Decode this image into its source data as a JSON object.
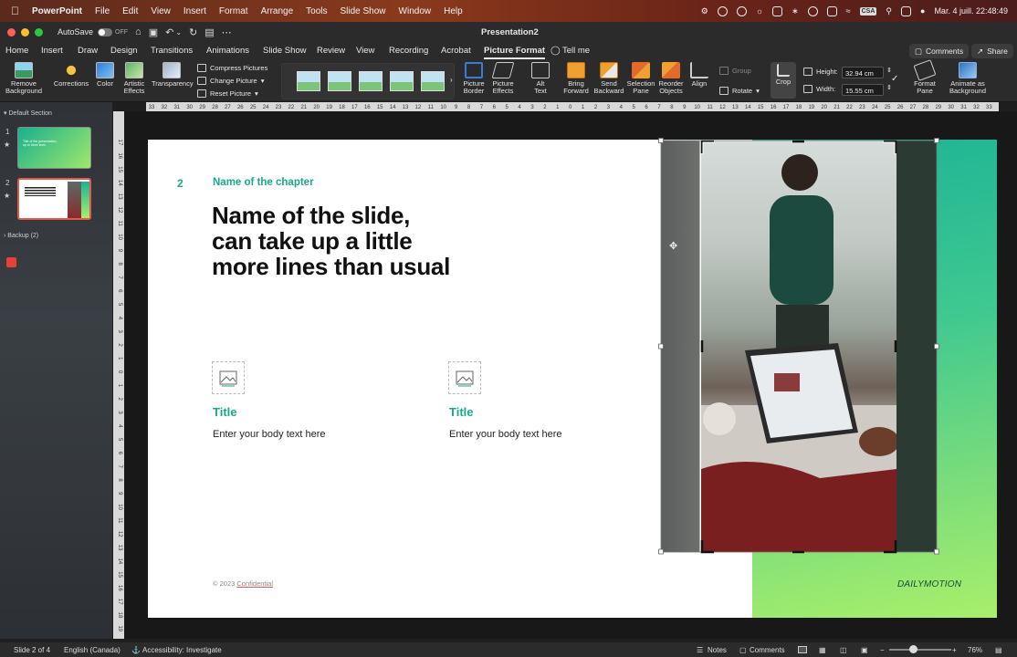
{
  "menubar": {
    "app": "PowerPoint",
    "items": [
      "File",
      "Edit",
      "View",
      "Insert",
      "Format",
      "Arrange",
      "Tools",
      "Slide Show",
      "Window",
      "Help"
    ],
    "input_source": "CSA",
    "datetime": "Mar. 4 juill. 22:48:49"
  },
  "titlebar": {
    "autosave_label": "AutoSave",
    "autosave_state": "OFF",
    "document_title": "Presentation2"
  },
  "tabs": {
    "items": [
      "Home",
      "Insert",
      "Draw",
      "Design",
      "Transitions",
      "Animations",
      "Slide Show",
      "Review",
      "View",
      "Recording",
      "Acrobat",
      "Picture Format"
    ],
    "active": "Picture Format",
    "tell_me": "Tell me",
    "comments": "Comments",
    "share": "Share"
  },
  "ribbon": {
    "remove_background": "Remove Background",
    "corrections": "Corrections",
    "color": "Color",
    "artistic_effects": "Artistic Effects",
    "transparency": "Transparency",
    "compress_pictures": "Compress Pictures",
    "change_picture": "Change Picture",
    "reset_picture": "Reset Picture",
    "picture_border": "Picture Border",
    "picture_effects": "Picture Effects",
    "alt_text": "Alt Text",
    "bring_forward": "Bring Forward",
    "send_backward": "Send Backward",
    "selection_pane": "Selection Pane",
    "reorder_objects": "Reorder Objects",
    "align": "Align",
    "group": "Group",
    "rotate": "Rotate",
    "crop": "Crop",
    "height_label": "Height:",
    "height_value": "32.94 cm",
    "width_label": "Width:",
    "width_value": "15.55 cm",
    "format_pane": "Format Pane",
    "animate_as_background": "Animate as Background"
  },
  "ruler": {
    "h_ticks": [
      "33",
      "32",
      "31",
      "30",
      "29",
      "28",
      "27",
      "26",
      "25",
      "24",
      "23",
      "22",
      "21",
      "20",
      "19",
      "18",
      "17",
      "16",
      "15",
      "14",
      "13",
      "12",
      "11",
      "10",
      "9",
      "8",
      "7",
      "6",
      "5",
      "4",
      "3",
      "2",
      "1",
      "0",
      "1",
      "2",
      "3",
      "4",
      "5",
      "6",
      "7",
      "8",
      "9",
      "10",
      "11",
      "12",
      "13",
      "14",
      "15",
      "16",
      "17",
      "18",
      "19",
      "20",
      "21",
      "22",
      "23",
      "24",
      "25",
      "26",
      "27",
      "28",
      "29",
      "30",
      "31",
      "32",
      "33"
    ],
    "v_ticks": [
      "17",
      "16",
      "15",
      "14",
      "13",
      "12",
      "11",
      "10",
      "9",
      "8",
      "7",
      "6",
      "5",
      "4",
      "3",
      "2",
      "1",
      "0",
      "1",
      "2",
      "3",
      "4",
      "5",
      "6",
      "7",
      "8",
      "9",
      "10",
      "11",
      "12",
      "13",
      "14",
      "15",
      "16",
      "17",
      "18",
      "19"
    ]
  },
  "thumbnails": {
    "section_default": "Default Section",
    "section_backup": "Backup (2)",
    "slide1_number": "1",
    "slide2_number": "2",
    "slide1_title": "Title of the presentation, up to three lines"
  },
  "slide": {
    "chapter_number": "2",
    "chapter_name": "Name of the chapter",
    "title_line1": "Name of the slide,",
    "title_line2": "can take up a little",
    "title_line3": "more lines than usual",
    "col1_title": "Title",
    "col1_body": "Enter your body text here",
    "col2_title": "Title",
    "col2_body": "Enter your body text here",
    "copyright": "© 2023",
    "confidential": "Confidential",
    "brand": "DAILYMOTION"
  },
  "status": {
    "slide_info": "Slide 2 of 4",
    "language": "English (Canada)",
    "accessibility": "Accessibility: Investigate",
    "notes": "Notes",
    "comments": "Comments",
    "zoom": "76%"
  },
  "colors": {
    "accent_green": "#1aa88a",
    "active_thumb_border": "#e35a4b",
    "slide_gradient_start": "#1cb394",
    "slide_gradient_end": "#a9ef6a"
  }
}
